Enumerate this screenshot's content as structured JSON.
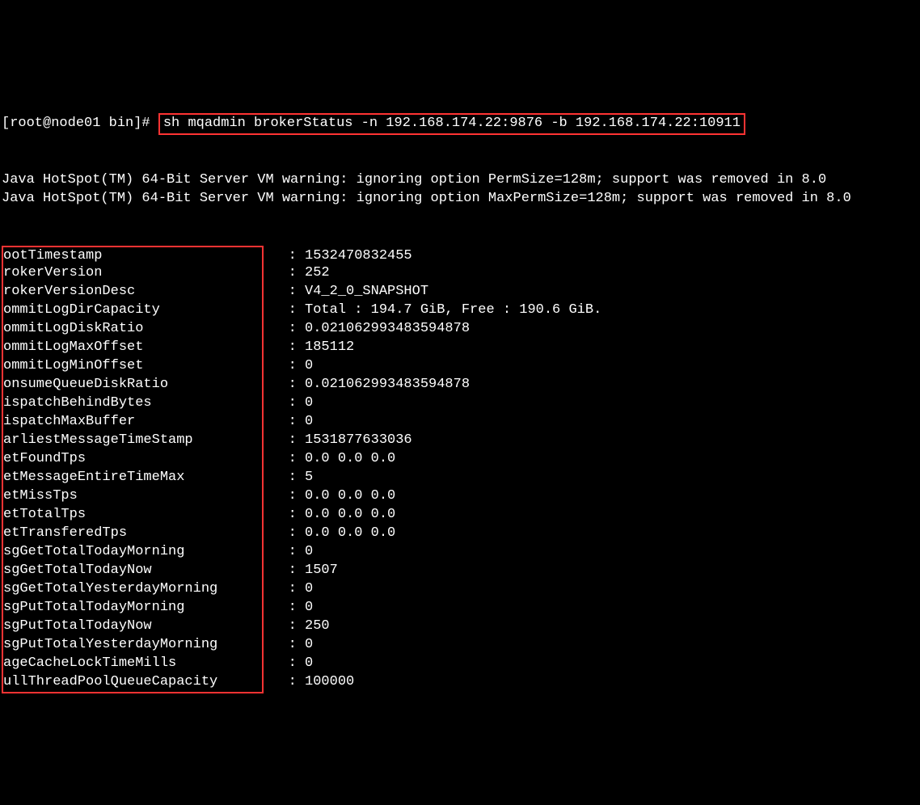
{
  "prompt": {
    "prefix": "[root@node01 bin]# ",
    "command": "sh mqadmin brokerStatus -n 192.168.174.22:9876 -b 192.168.174.22:10911"
  },
  "warnings": [
    "Java HotSpot(TM) 64-Bit Server VM warning: ignoring option PermSize=128m; support was removed in 8.0",
    "Java HotSpot(TM) 64-Bit Server VM warning: ignoring option MaxPermSize=128m; support was removed in 8.0"
  ],
  "status": [
    {
      "key": "bootTimestamp",
      "value": "1532470832455"
    },
    {
      "key": "brokerVersion",
      "value": "252"
    },
    {
      "key": "brokerVersionDesc",
      "value": "V4_2_0_SNAPSHOT"
    },
    {
      "key": "commitLogDirCapacity",
      "value": "Total : 194.7 GiB, Free : 190.6 GiB."
    },
    {
      "key": "commitLogDiskRatio",
      "value": "0.021062993483594878"
    },
    {
      "key": "commitLogMaxOffset",
      "value": "185112"
    },
    {
      "key": "commitLogMinOffset",
      "value": "0"
    },
    {
      "key": "consumeQueueDiskRatio",
      "value": "0.021062993483594878"
    },
    {
      "key": "dispatchBehindBytes",
      "value": "0"
    },
    {
      "key": "dispatchMaxBuffer",
      "value": "0"
    },
    {
      "key": "earliestMessageTimeStamp",
      "value": "1531877633036"
    },
    {
      "key": "getFoundTps",
      "value": "0.0 0.0 0.0"
    },
    {
      "key": "getMessageEntireTimeMax",
      "value": "5"
    },
    {
      "key": "getMissTps",
      "value": "0.0 0.0 0.0"
    },
    {
      "key": "getTotalTps",
      "value": "0.0 0.0 0.0"
    },
    {
      "key": "getTransferedTps",
      "value": "0.0 0.0 0.0"
    },
    {
      "key": "msgGetTotalTodayMorning",
      "value": "0"
    },
    {
      "key": "msgGetTotalTodayNow",
      "value": "1507"
    },
    {
      "key": "msgGetTotalYesterdayMorning",
      "value": "0"
    },
    {
      "key": "msgPutTotalTodayMorning",
      "value": "0"
    },
    {
      "key": "msgPutTotalTodayNow",
      "value": "250"
    },
    {
      "key": "msgPutTotalYesterdayMorning",
      "value": "0"
    },
    {
      "key": "pageCacheLockTimeMills",
      "value": "0"
    },
    {
      "key": "pullThreadPoolQueueCapacity",
      "value": "100000"
    }
  ]
}
